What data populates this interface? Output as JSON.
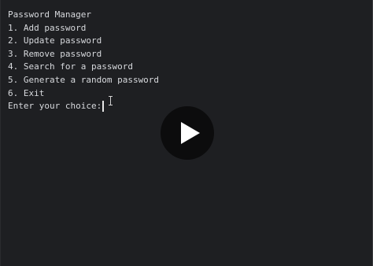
{
  "terminal": {
    "title_line": "Password Manager",
    "menu": [
      {
        "label": "1. Add password"
      },
      {
        "label": "2. Update password"
      },
      {
        "label": "3. Remove password"
      },
      {
        "label": "4. Search for a password"
      },
      {
        "label": "5. Generate a random password"
      },
      {
        "label": "6. Exit"
      }
    ],
    "prompt": "Enter your choice:",
    "input_value": ""
  },
  "overlay": {
    "icon": "play-icon"
  },
  "colors": {
    "background": "#1e1f22",
    "text": "#d7d9dd",
    "play_button_bg": "#0c0c0d",
    "play_icon": "#ffffff"
  }
}
